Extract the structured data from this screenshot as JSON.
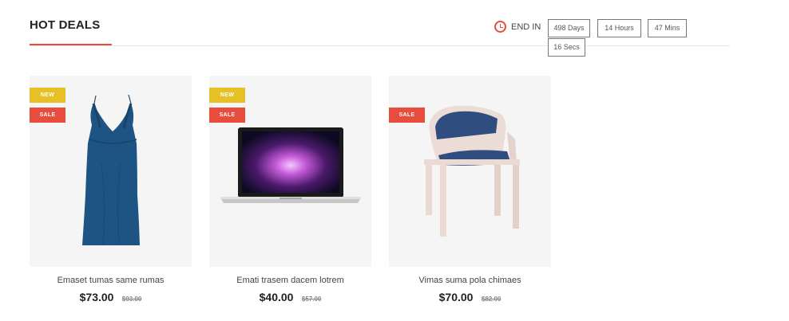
{
  "section": {
    "title": "HOT DEALS"
  },
  "countdown": {
    "label": "END IN",
    "days": "498 Days",
    "hours": "14 Hours",
    "mins": "47 Mins",
    "secs": "16 Secs"
  },
  "products": [
    {
      "name": "Emaset tumas same rumas",
      "price": "$73.00",
      "old_price": "$93.00",
      "badges": [
        "NEW",
        "SALE"
      ],
      "icon": "dress-image"
    },
    {
      "name": "Emati trasem dacem lotrem",
      "price": "$40.00",
      "old_price": "$57.00",
      "badges": [
        "NEW",
        "SALE"
      ],
      "icon": "laptop-image"
    },
    {
      "name": "Vimas suma pola chimaes",
      "price": "$70.00",
      "old_price": "$82.00",
      "badges": [
        "SALE"
      ],
      "icon": "chair-image"
    }
  ],
  "colors": {
    "accent": "#e74c3c",
    "new_badge": "#e6c024",
    "image_bg": "#f5f5f5"
  }
}
